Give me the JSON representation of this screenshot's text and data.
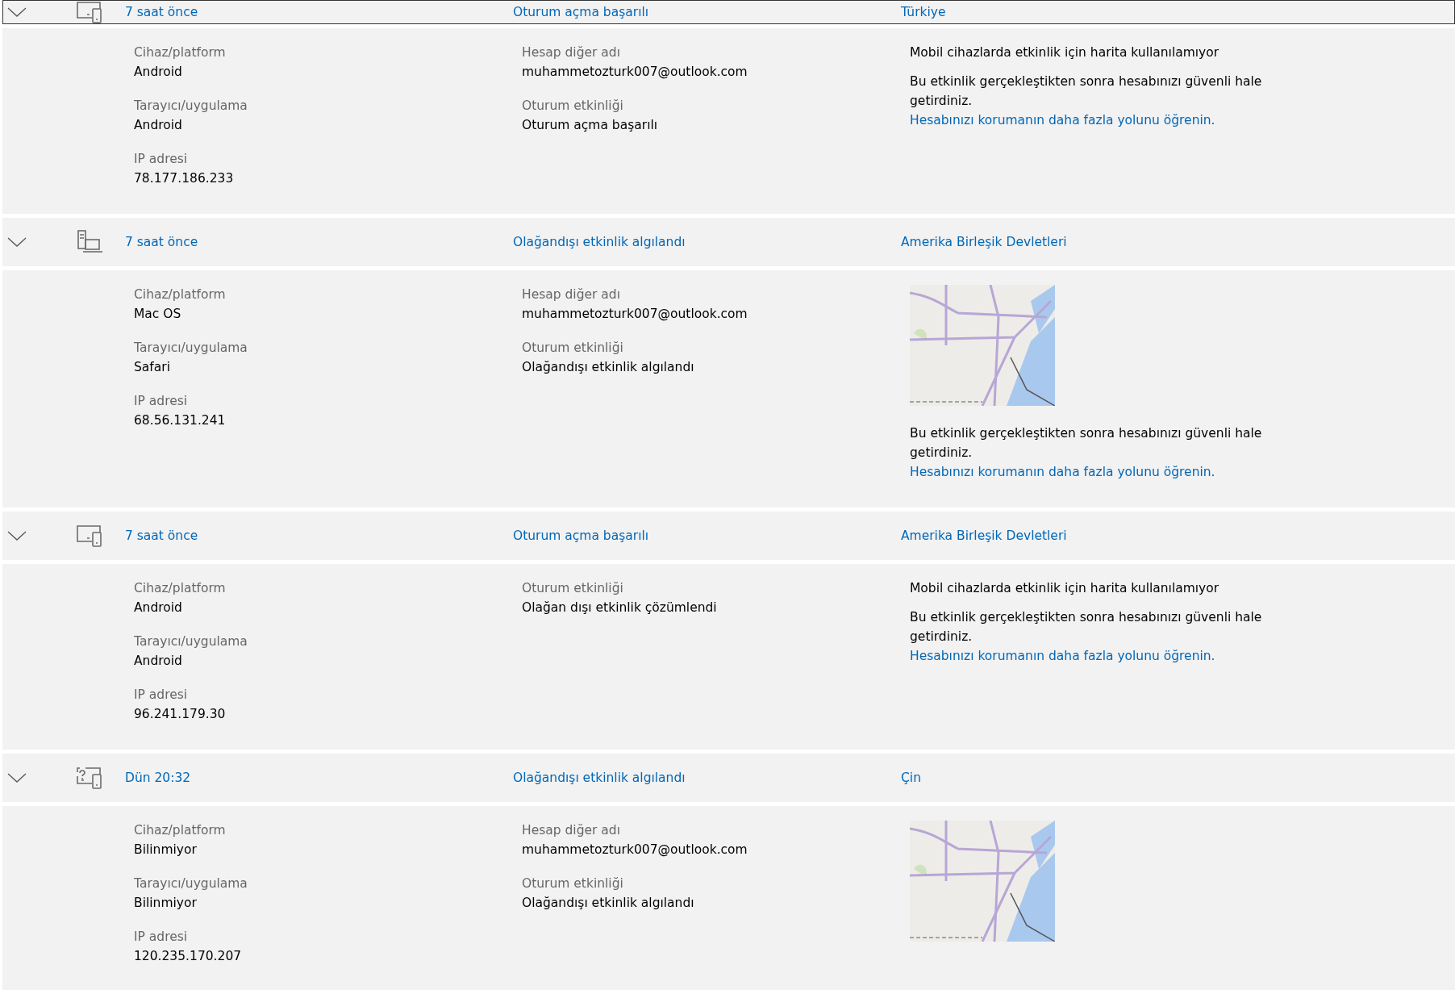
{
  "activities": [
    {
      "time": "7 saat önce",
      "status": "Oturum açma başarılı",
      "location": "Türkiye",
      "kind": "phone-tablet",
      "expanded": true,
      "focused": true,
      "left": [
        {
          "label": "Cihaz/platform",
          "value": "Android"
        },
        {
          "label": "Tarayıcı/uygulama",
          "value": "Android"
        },
        {
          "label": "IP adresi",
          "value": "78.177.186.233"
        }
      ],
      "middle": [
        {
          "label": "Hesap diğer adı",
          "value": "muhammetozturk007@outlook.com"
        },
        {
          "label": "Oturum etkinliği",
          "value": "Oturum açma başarılı"
        }
      ],
      "right": {
        "kind": "no-map",
        "map_note": "Mobil cihazlarda etkinlik için harita kullanılamıyor",
        "note": "Bu etkinlik gerçekleştikten sonra hesabınızı güvenli hale getirdiniz.",
        "link": "Hesabınızı korumanın daha fazla yolunu öğrenin."
      }
    },
    {
      "time": "7 saat önce",
      "status": "Olağandışı etkinlik algılandı",
      "location": "Amerika Birleşik Devletleri",
      "kind": "desktop-laptop",
      "expanded": true,
      "focused": false,
      "left": [
        {
          "label": "Cihaz/platform",
          "value": "Mac OS"
        },
        {
          "label": "Tarayıcı/uygulama",
          "value": "Safari"
        },
        {
          "label": "IP adresi",
          "value": "68.56.131.241"
        }
      ],
      "middle": [
        {
          "label": "Hesap diğer adı",
          "value": "muhammetozturk007@outlook.com"
        },
        {
          "label": "Oturum etkinliği",
          "value": "Olağandışı etkinlik algılandı"
        }
      ],
      "right": {
        "kind": "map",
        "note": "Bu etkinlik gerçekleştikten sonra hesabınızı güvenli hale getirdiniz.",
        "link": "Hesabınızı korumanın daha fazla yolunu öğrenin."
      }
    },
    {
      "time": "7 saat önce",
      "status": "Oturum açma başarılı",
      "location": "Amerika Birleşik Devletleri",
      "kind": "phone-tablet",
      "expanded": true,
      "focused": false,
      "left": [
        {
          "label": "Cihaz/platform",
          "value": "Android"
        },
        {
          "label": "Tarayıcı/uygulama",
          "value": "Android"
        },
        {
          "label": "IP adresi",
          "value": "96.241.179.30"
        }
      ],
      "middle": [
        {
          "label": "Oturum etkinliği",
          "value": "Olağan dışı etkinlik çözümlendi"
        }
      ],
      "right": {
        "kind": "no-map",
        "map_note": "Mobil cihazlarda etkinlik için harita kullanılamıyor",
        "note": "Bu etkinlik gerçekleştikten sonra hesabınızı güvenli hale getirdiniz.",
        "link": "Hesabınızı korumanın daha fazla yolunu öğrenin."
      }
    },
    {
      "time": "Dün 20:32",
      "status": "Olağandışı etkinlik algılandı",
      "location": "Çin",
      "kind": "unknown",
      "expanded": true,
      "focused": false,
      "left": [
        {
          "label": "Cihaz/platform",
          "value": "Bilinmiyor"
        },
        {
          "label": "Tarayıcı/uygulama",
          "value": "Bilinmiyor"
        },
        {
          "label": "IP adresi",
          "value": "120.235.170.207"
        }
      ],
      "middle": [
        {
          "label": "Hesap diğer adı",
          "value": "muhammetozturk007@outlook.com"
        },
        {
          "label": "Oturum etkinliği",
          "value": "Olağandışı etkinlik algılandı"
        }
      ],
      "right": {
        "kind": "map"
      }
    }
  ]
}
